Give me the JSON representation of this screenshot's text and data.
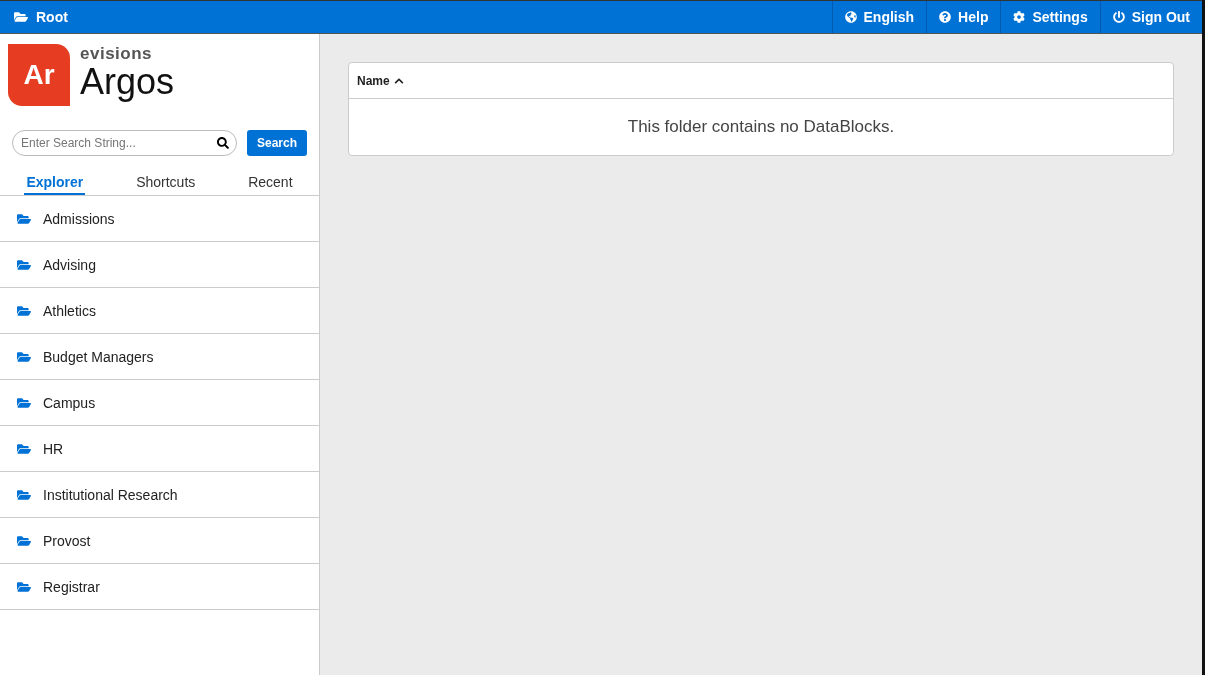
{
  "top_bar": {
    "breadcrumb": "Root",
    "actions": [
      {
        "kind": "language",
        "label": "English"
      },
      {
        "kind": "help",
        "label": "Help"
      },
      {
        "kind": "settings",
        "label": "Settings"
      },
      {
        "kind": "signout",
        "label": "Sign Out"
      }
    ]
  },
  "logo": {
    "mark": "Ar",
    "brand": "evisions",
    "product": "Argos"
  },
  "search": {
    "placeholder": "Enter Search String...",
    "button": "Search"
  },
  "tabs": [
    {
      "label": "Explorer",
      "selected": true
    },
    {
      "label": "Shortcuts",
      "selected": false
    },
    {
      "label": "Recent",
      "selected": false
    }
  ],
  "folders": [
    "Admissions",
    "Advising",
    "Athletics",
    "Budget Managers",
    "Campus",
    "HR",
    "Institutional Research",
    "Provost",
    "Registrar"
  ],
  "table": {
    "column": "Name",
    "empty_message": "This folder contains no DataBlocks."
  }
}
